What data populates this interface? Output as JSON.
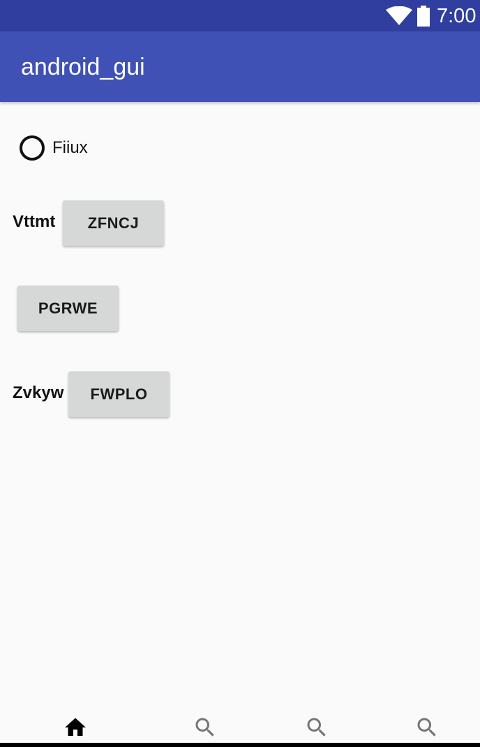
{
  "status_bar": {
    "time": "7:00",
    "icons": [
      "wifi-icon",
      "battery-icon"
    ],
    "color": "#303f9f"
  },
  "app_bar": {
    "title": "android_gui",
    "color": "#3f51b5"
  },
  "content": {
    "radio": {
      "label": "Fiiux",
      "checked": false
    },
    "row1": {
      "label": "Vttmt",
      "button": "ZFNCJ"
    },
    "row2": {
      "button": "PGRWE"
    },
    "row3": {
      "label": "Zvkyw",
      "button": "FWPLO"
    }
  },
  "bottom_nav": {
    "items": [
      {
        "icon": "home-icon",
        "selected": true
      },
      {
        "icon": "search-icon",
        "selected": false
      },
      {
        "icon": "search-icon",
        "selected": false
      },
      {
        "icon": "search-icon",
        "selected": false
      }
    ]
  }
}
